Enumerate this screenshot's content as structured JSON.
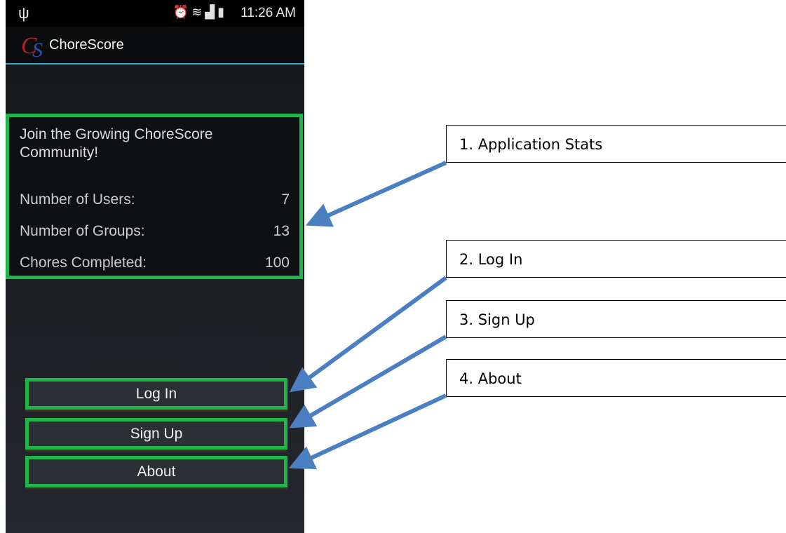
{
  "status_bar": {
    "time": "11:26 AM",
    "icons": [
      "usb-icon",
      "alarm-icon",
      "wifi-icon",
      "signal-icon",
      "battery-icon"
    ]
  },
  "app": {
    "title": "ChoreScore",
    "logo_text": "CS"
  },
  "stats": {
    "heading": "Join the Growing ChoreScore Community!",
    "rows": [
      {
        "label": "Number of Users:",
        "value": "7"
      },
      {
        "label": "Number of Groups:",
        "value": "13"
      },
      {
        "label": "Chores Completed:",
        "value": "100"
      }
    ]
  },
  "buttons": {
    "login": "Log In",
    "signup": "Sign Up",
    "about": "About"
  },
  "callouts": [
    "1. Application Stats",
    "2. Log In",
    "3. Sign Up",
    "4. About"
  ],
  "colors": {
    "highlight": "#1fb54a",
    "arrow": "#4a7fc1",
    "accent_line": "#3aa4d9"
  }
}
